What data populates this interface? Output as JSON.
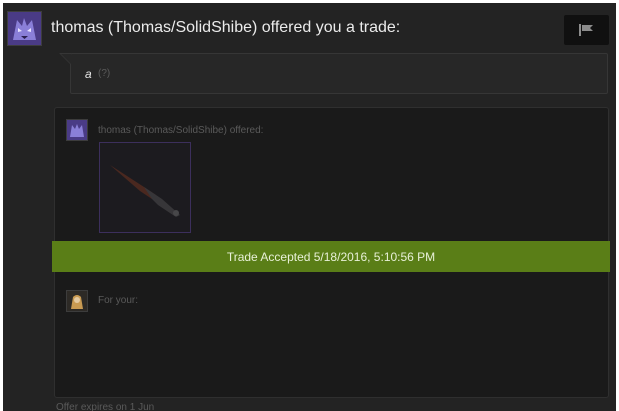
{
  "header": {
    "title": "thomas (Thomas/SolidShibe) offered you a trade:"
  },
  "message": {
    "text": "a",
    "help": "(?)"
  },
  "offer": {
    "label": "thomas (Thomas/SolidShibe) offered:"
  },
  "status": {
    "text": "Trade Accepted 5/18/2016, 5:10:56 PM"
  },
  "your_side": {
    "label": "For your:"
  },
  "footer": {
    "expires": "Offer expires on 1 Jun"
  },
  "colors": {
    "background": "#232323",
    "panel": "#1a1a1a",
    "accepted": "#5a7e17",
    "title_text": "#ebebeb"
  },
  "icons": {
    "avatar": "purple-wolf-avatar",
    "flag": "flag-icon",
    "item": "knife-item-icon"
  }
}
